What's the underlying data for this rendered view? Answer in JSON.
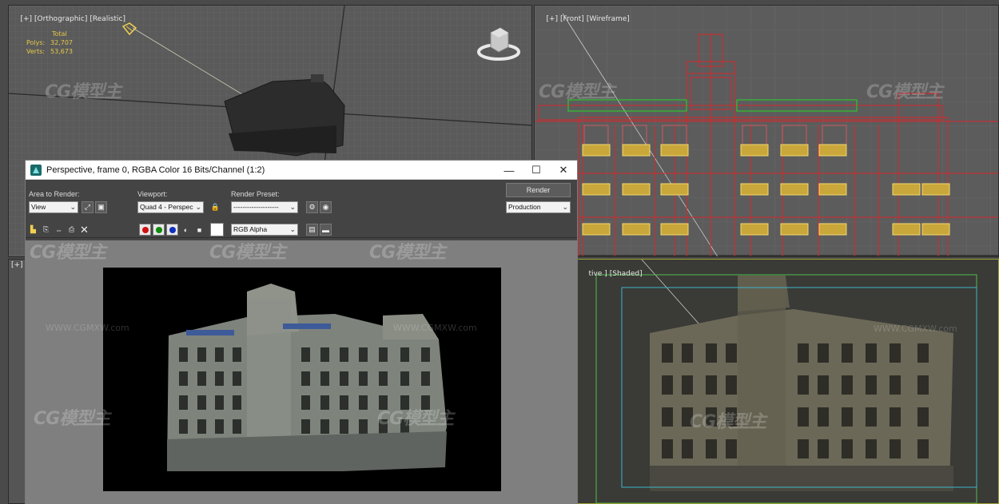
{
  "viewports": {
    "top_left": {
      "labels": [
        "[+]",
        "[Orthographic]",
        "[Realistic]"
      ]
    },
    "top_right": {
      "labels": [
        "[+]",
        "[Front]",
        "[Wireframe]"
      ]
    },
    "bottom_left": {
      "labels": [
        "[+]"
      ]
    },
    "bottom_right": {
      "labels": [
        "tive ]",
        "[Shaded]"
      ]
    }
  },
  "stats": {
    "header": "Total",
    "polys_label": "Polys:",
    "polys_value": "32,707",
    "verts_label": "Verts:",
    "verts_value": "53,673"
  },
  "render_window": {
    "title": "Perspective, frame 0, RGBA Color 16 Bits/Channel (1:2)",
    "area_to_render_label": "Area to Render:",
    "area_to_render_value": "View",
    "viewport_label": "Viewport:",
    "viewport_value": "Quad 4 - Perspec",
    "render_preset_label": "Render Preset:",
    "render_preset_value": "--------------------",
    "render_button": "Render",
    "production_value": "Production",
    "channel_value": "RGB Alpha"
  },
  "watermark": {
    "logo": "CG模型主",
    "url": "WWW.CGMXW.com"
  },
  "colors": {
    "viewport_bg": "#5a5a5a",
    "wire_red": "#d8262b",
    "wire_yellow": "#f0d050",
    "wire_green": "#2dc52d",
    "safe_frame_green": "#4fbf4f",
    "safe_frame_cyan": "#3fb7c9",
    "stats_yellow": "#e5c84b"
  }
}
